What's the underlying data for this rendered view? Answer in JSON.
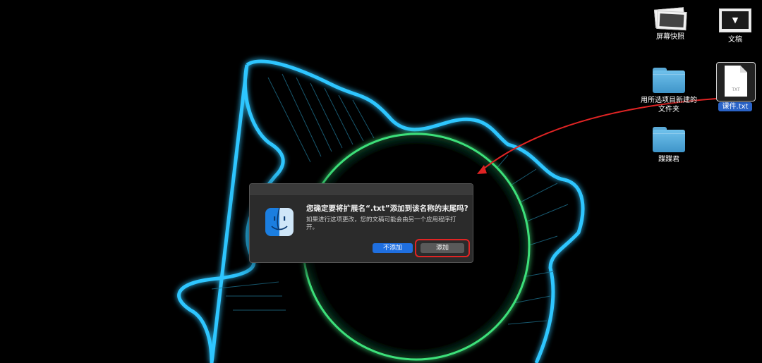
{
  "desktop": {
    "icons": {
      "screenshot": {
        "label": "屏幕快照"
      },
      "document": {
        "label": "文稿"
      },
      "new_folder": {
        "label": "用所选项目新建的文件夹"
      },
      "txt_file": {
        "label": "课件.txt",
        "type_text": "TXT"
      },
      "folder2": {
        "label": "蹀蹀君"
      }
    }
  },
  "dialog": {
    "title": "您确定要将扩展名“.txt”添加到该名称的末尾吗?",
    "body": "如果进行这项更改，您的文稿可能会由另一个应用程序打开。",
    "cancel_label": "不添加",
    "confirm_label": "添加",
    "icon": "finder-icon"
  },
  "colors": {
    "accent_blue": "#1f6fe0",
    "annotation_red": "#e02424",
    "glow_blue": "#2fc6ff",
    "ring_green": "#3ee07a"
  }
}
